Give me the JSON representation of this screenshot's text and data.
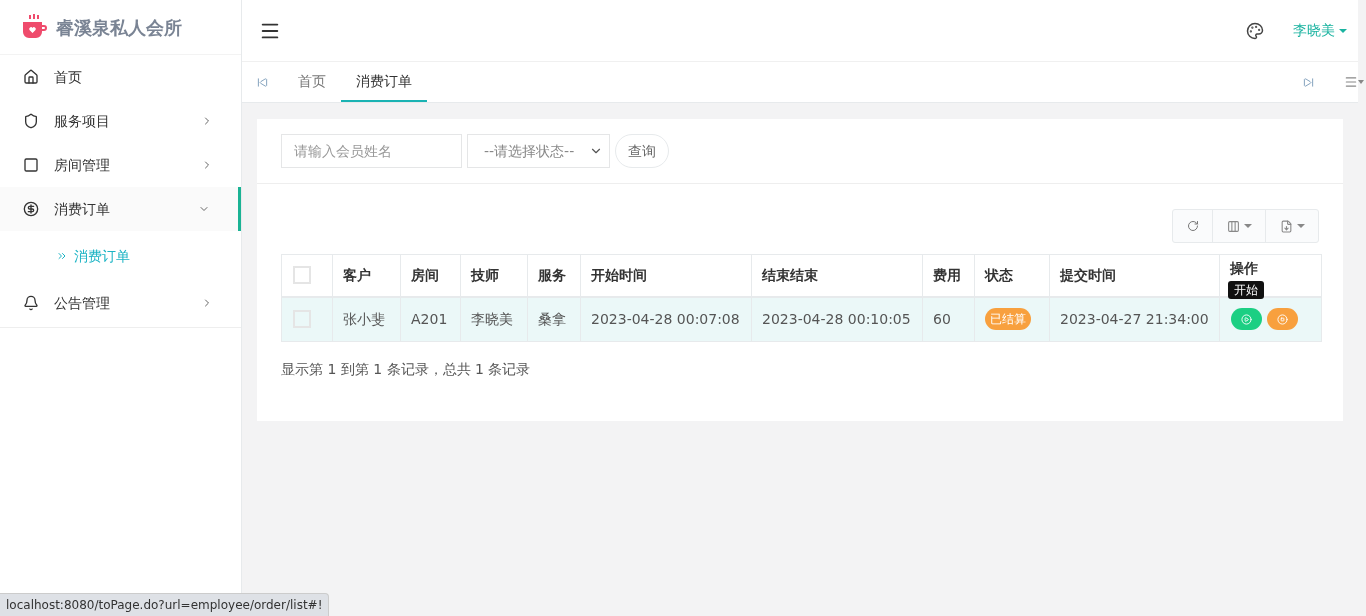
{
  "brand": {
    "title": "睿溪泉私人会所"
  },
  "sidebar": {
    "items": [
      {
        "label": "首页",
        "has_arrow": false,
        "selected": false
      },
      {
        "label": "服务项目",
        "has_arrow": true,
        "expanded": false,
        "selected": false
      },
      {
        "label": "房间管理",
        "has_arrow": true,
        "expanded": false,
        "selected": false
      },
      {
        "label": "消费订单",
        "has_arrow": true,
        "expanded": true,
        "selected": true,
        "children": [
          {
            "label": "消费订单",
            "selected": true
          }
        ]
      },
      {
        "label": "公告管理",
        "has_arrow": true,
        "expanded": false,
        "selected": false
      }
    ]
  },
  "header": {
    "user": "李晓美"
  },
  "tabs": [
    {
      "label": "首页",
      "selected": false
    },
    {
      "label": "消费订单",
      "selected": true
    }
  ],
  "search": {
    "placeholder": "请输入会员姓名",
    "status_select": "--请选择状态--",
    "button": "查询"
  },
  "table": {
    "all_checked": false,
    "columns": [
      "客户",
      "房间",
      "技师",
      "服务",
      "开始时间",
      "结束结束",
      "费用",
      "状态",
      "提交时间",
      "操作"
    ],
    "rows": [
      {
        "checked": false,
        "highlighted": true,
        "cells": [
          "张小斐",
          "A201",
          "李晓美",
          "桑拿",
          "2023-04-28 00:07:08",
          "2023-04-28 00:10:05",
          "60"
        ],
        "status": "已结算",
        "submitted": "2023-04-27 21:34:00"
      }
    ]
  },
  "tooltip": "开始",
  "footer": "显示第 1 到第 1 条记录，总共 1 条记录",
  "status_bar": "localhost:8080/toPage.do?url=employee/order/list#!"
}
